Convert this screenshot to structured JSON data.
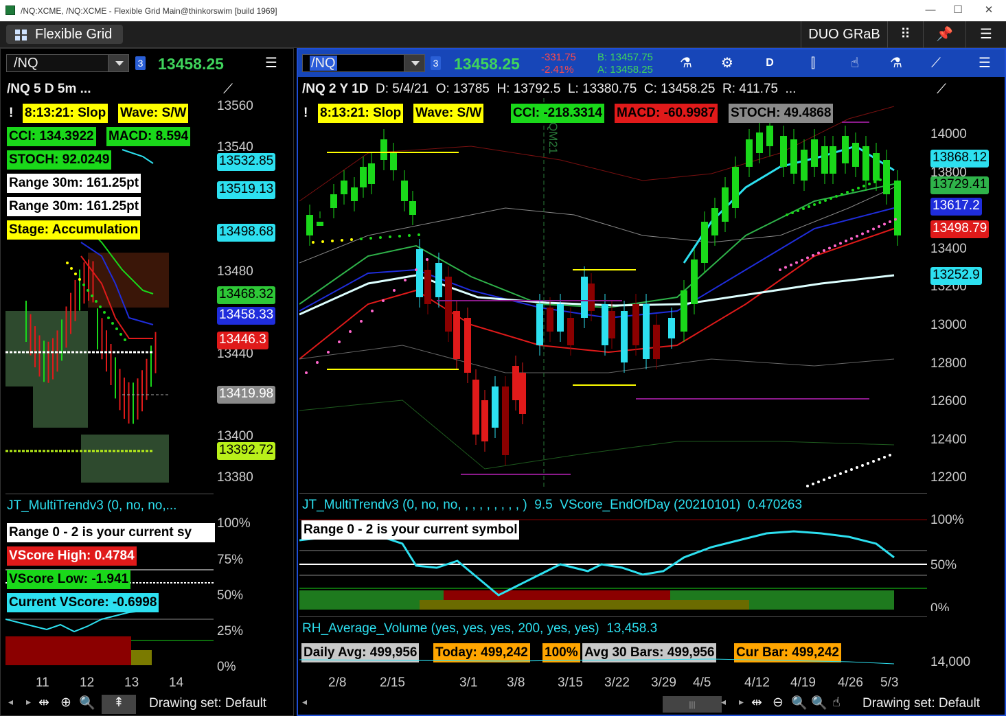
{
  "window": {
    "title": "/NQ:XCME, /NQ:XCME - Flexible Grid Main@thinkorswim [build 1969]",
    "minimize": "—",
    "maximize": "☐",
    "close": "✕"
  },
  "menubar": {
    "flexible_grid": "Flexible Grid",
    "duo": "DUO GRaB",
    "grid_icon": "grid-icon",
    "pin_icon": "pin-icon",
    "menu_icon": "menu-icon"
  },
  "left": {
    "symbol": "/NQ",
    "badge": "3",
    "price": "13458.25",
    "menu": "☰",
    "title": "/NQ 5 D 5m ...",
    "labels": {
      "slop": "8:13:21: Slop",
      "wave": "Wave: S/W",
      "cci": "CCI: 134.3922",
      "macd": "MACD: 8.594",
      "stoch": "STOCH: 92.0249",
      "range1": "Range 30m: 161.25pt",
      "range2": "Range 30m: 161.25pt",
      "stage": "Stage: Accumulation"
    },
    "axis": [
      "13560",
      "13540",
      "13480",
      "13440",
      "13400",
      "13380"
    ],
    "tags": [
      {
        "t": "13532.85",
        "bg": "#2de0f0"
      },
      {
        "t": "13519.13",
        "bg": "#2de0f0"
      },
      {
        "t": "13498.68",
        "bg": "#2de0f0"
      },
      {
        "t": "13468.32",
        "bg": "#2ec837"
      },
      {
        "t": "13458.33",
        "bg": "#1f2ddc"
      },
      {
        "t": "13446.3",
        "bg": "#e01a1a"
      },
      {
        "t": "13419.98",
        "bg": "#8a8a8a"
      },
      {
        "t": "13392.72",
        "bg": "#b9f01a"
      }
    ],
    "study_title": "JT_MultiTrendv3 (0, no, no,...",
    "study_labels": {
      "range": "Range 0 - 2 is your current sy",
      "vhigh": "VScore High: 0.4784",
      "vlow": "VScore Low: -1.941",
      "vcur": "Current VScore: -0.6998"
    },
    "study_axis": [
      "100%",
      "75%",
      "50%",
      "25%",
      "0%"
    ],
    "xlabels": [
      "11",
      "12",
      "13",
      "14"
    ],
    "drawing": "Drawing set: Default"
  },
  "right": {
    "symbol": "/NQ",
    "badge": "3",
    "price": "13458.25",
    "chg": "-331.75",
    "pct": "-2.41%",
    "bid": "B: 13457.75",
    "ask": "A: 13458.25",
    "toolbar": {
      "d": "D"
    },
    "title": "/NQ 2 Y 1D",
    "ohlc": {
      "d": "D: 5/4/21",
      "o": "O: 13785",
      "h": "H: 13792.5",
      "l": "L: 13380.75",
      "c": "C: 13458.25",
      "r": "R: 411.75",
      "more": "..."
    },
    "labels": {
      "slop": "8:13:21: Slop",
      "wave": "Wave: S/W",
      "cci": "CCI: -218.3314",
      "macd": "MACD: -60.9987",
      "stoch": "STOCH: 49.4868"
    },
    "expiry": "QM21",
    "axis": [
      "14000",
      "13800",
      "13400",
      "13200",
      "13000",
      "12800",
      "12600",
      "12400",
      "12200"
    ],
    "tags": [
      {
        "t": "13868.12",
        "bg": "#2de0f0"
      },
      {
        "t": "13729.41",
        "bg": "#2fb34a"
      },
      {
        "t": "13617.2",
        "bg": "#1f2ddc"
      },
      {
        "t": "13498.79",
        "bg": "#e01a1a"
      },
      {
        "t": "13252.9",
        "bg": "#2de0f0"
      }
    ],
    "study1": {
      "title": "JT_MultiTrendv3 (0, no, no, , , , , , , , , )",
      "v1": "9.5",
      "v2": "VScore_EndOfDay (20210101)",
      "v3": "0.470263",
      "label": "Range 0 - 2 is your current symbol",
      "axis": [
        "100%",
        "50%",
        "0%"
      ]
    },
    "study2": {
      "title": "RH_Average_Volume (yes, yes, yes, 200, yes, yes)",
      "val": "13,458.3",
      "daily": "Daily Avg: 499,956",
      "today": "Today: 499,242",
      "pct": "100%",
      "avg30": "Avg 30 Bars: 499,956",
      "cur": "Cur Bar: 499,242",
      "axis": "14,000"
    },
    "xlabels": [
      "2/8",
      "2/15",
      "3/1",
      "3/8",
      "3/15",
      "3/22",
      "3/29",
      "4/5",
      "4/12",
      "4/19",
      "4/26",
      "5/3"
    ],
    "drawing": "Drawing set: Default"
  }
}
